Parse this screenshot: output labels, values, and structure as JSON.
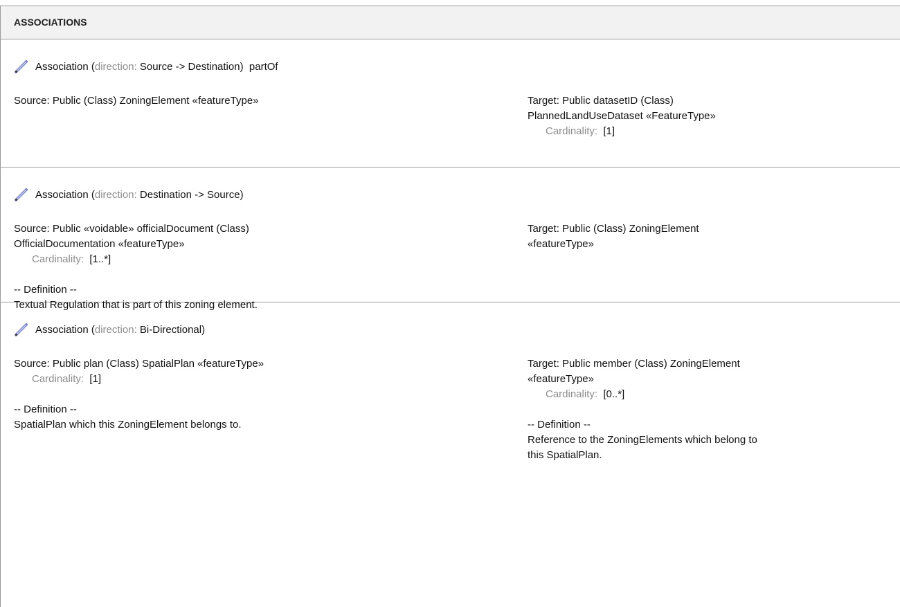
{
  "section": {
    "title": "ASSOCIATIONS"
  },
  "associations": [
    {
      "prefix": "Association (",
      "direction_label": "direction:",
      "direction_value": " Source -> Destination)  partOf",
      "icon": "pencil-icon",
      "source": {
        "line1": "Source: Public (Class) ZoningElement «featureType»"
      },
      "target": {
        "line1": "Target: Public datasetID (Class)",
        "line2": "PlannedLandUseDataset «FeatureType»",
        "card_label": "Cardinality:",
        "card_value": "[1]"
      }
    },
    {
      "prefix": "Association (",
      "direction_label": "direction:",
      "direction_value": " Destination -> Source)",
      "icon": "pencil-icon",
      "source": {
        "line1": "Source: Public «voidable» officialDocument (Class)",
        "line2": "OfficialDocumentation «featureType»",
        "card_label": "Cardinality:",
        "card_value": "[1..*]",
        "def_heading": "-- Definition --",
        "def_text": "Textual Regulation that is part of this zoning element."
      },
      "target": {
        "line1": "Target: Public (Class) ZoningElement",
        "line2": "«featureType»"
      }
    },
    {
      "prefix": "Association (",
      "direction_label": "direction:",
      "direction_value": " Bi-Directional)",
      "icon": "pencil-icon",
      "source": {
        "line1": "Source: Public plan (Class) SpatialPlan «featureType»",
        "card_label": "Cardinality:",
        "card_value": "[1]",
        "def_heading": "-- Definition --",
        "def_text": "SpatialPlan which this ZoningElement belongs to."
      },
      "target": {
        "line1": "Target: Public member (Class) ZoningElement",
        "line2": "«featureType»",
        "card_label": "Cardinality:",
        "card_value": "[0..*]",
        "def_heading": "-- Definition --",
        "def_text_line1": "Reference to the ZoningElements which belong to",
        "def_text_line2": "this SpatialPlan."
      }
    }
  ]
}
